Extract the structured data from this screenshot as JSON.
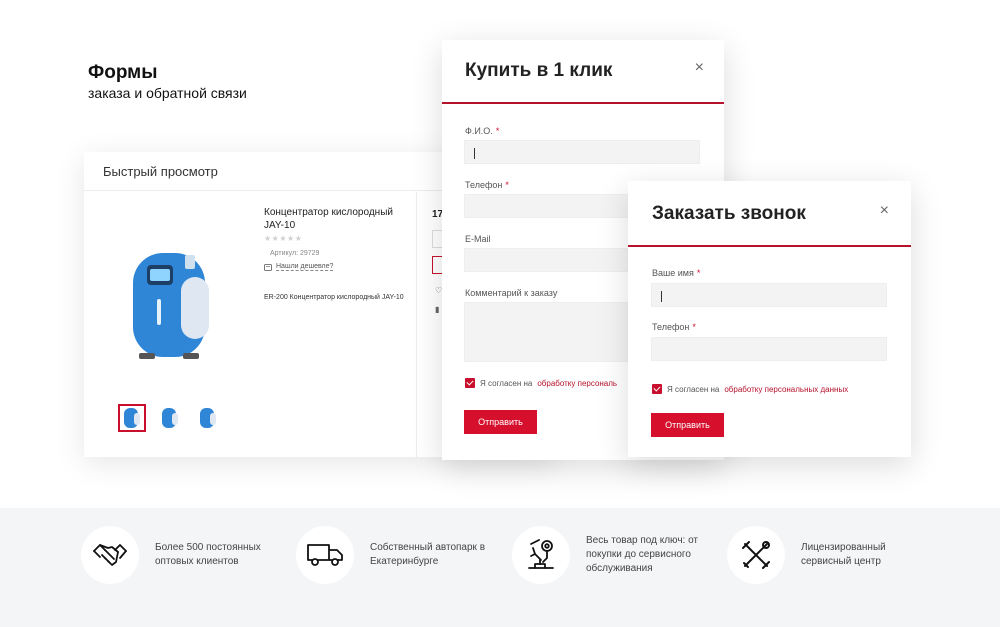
{
  "hero": {
    "title": "Формы",
    "subtitle": "заказа и обратной связи"
  },
  "quick_view": {
    "title": "Быстрый просмотр",
    "product": {
      "name": "Концентратор кислородный JAY-10",
      "stars": "★★★★★",
      "sku": "Артикул: 29729",
      "cheaper_link": "Нашли дешевле?",
      "description": "ER-200 Концентратор кислородный JAY-10",
      "price_partial": "17",
      "image_color": "#2f86d6"
    },
    "thumbnails": [
      {
        "active": true
      },
      {
        "active": false
      },
      {
        "active": false
      }
    ]
  },
  "modal_buy": {
    "title": "Купить в 1 клик",
    "close": "×",
    "fields": {
      "fio": {
        "label": "Ф.И.О.",
        "required": "*"
      },
      "phone": {
        "label": "Телефон",
        "required": "*"
      },
      "email": {
        "label": "E-Mail"
      },
      "comment": {
        "label": "Комментарий к заказу"
      }
    },
    "agree_text": "Я согласен на",
    "agree_link": "обработку персональ",
    "submit": "Отправить"
  },
  "modal_call": {
    "title": "Заказать звонок",
    "close": "×",
    "fields": {
      "name": {
        "label": "Ваше имя",
        "required": "*"
      },
      "phone": {
        "label": "Телефон",
        "required": "*"
      }
    },
    "agree_text": "Я согласен на",
    "agree_link": "обработку персональных данных",
    "submit": "Отправить"
  },
  "features": [
    {
      "icon": "handshake-icon",
      "line1": "Более 500 постоянных",
      "line2": "оптовых клиентов",
      "line3": ""
    },
    {
      "icon": "truck-icon",
      "line1": "Собственный автопарк в",
      "line2": "Екатеринбурге",
      "line3": ""
    },
    {
      "icon": "microscope-icon",
      "line1": "Весь товар под ключ: от",
      "line2": "покупки до сервисного",
      "line3": "обслуживания"
    },
    {
      "icon": "tools-icon",
      "line1": "Лицензированный",
      "line2": "сервисный центр",
      "line3": ""
    }
  ],
  "colors": {
    "accent": "#c8102e",
    "button": "#d6102c",
    "footer_bg": "#f4f5f7"
  }
}
